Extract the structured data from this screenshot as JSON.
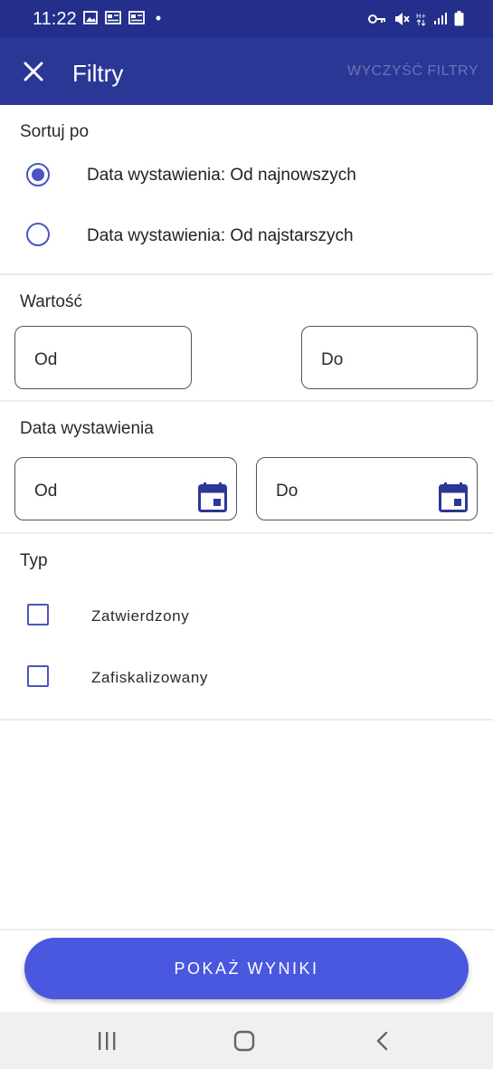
{
  "status_bar": {
    "time": "11:22",
    "left_icons": [
      "image-icon",
      "news-icon",
      "news-icon",
      "dot-icon"
    ],
    "right_icons": [
      "vpn-key-icon",
      "mute-icon",
      "data-arrows-icon",
      "signal-icon",
      "battery-icon"
    ]
  },
  "app_bar": {
    "title": "Filtry",
    "clear_label": "WYCZYŚĆ FILTRY",
    "close_icon": "close-icon"
  },
  "sort": {
    "title": "Sortuj po",
    "options": [
      {
        "label": "Data wystawienia: Od najnowszych",
        "selected": true
      },
      {
        "label": "Data wystawienia: Od najstarszych",
        "selected": false
      }
    ]
  },
  "value": {
    "title": "Wartość",
    "from_label": "Od",
    "to_label": "Do"
  },
  "issue_date": {
    "title": "Data wystawienia",
    "from_label": "Od",
    "to_label": "Do",
    "icon": "calendar-icon"
  },
  "type": {
    "title": "Typ",
    "options": [
      {
        "label": "Zatwierdzony",
        "checked": false
      },
      {
        "label": "Zafiskalizowany",
        "checked": false
      }
    ]
  },
  "footer": {
    "show_results_label": "POKAŻ WYNIKI"
  },
  "nav": {
    "items": [
      "recent-apps-icon",
      "home-icon",
      "back-icon"
    ]
  },
  "colors": {
    "status_bar": "#242f8c",
    "app_bar": "#2b3794",
    "accent": "#4a55c4",
    "button": "#4a58e0"
  }
}
